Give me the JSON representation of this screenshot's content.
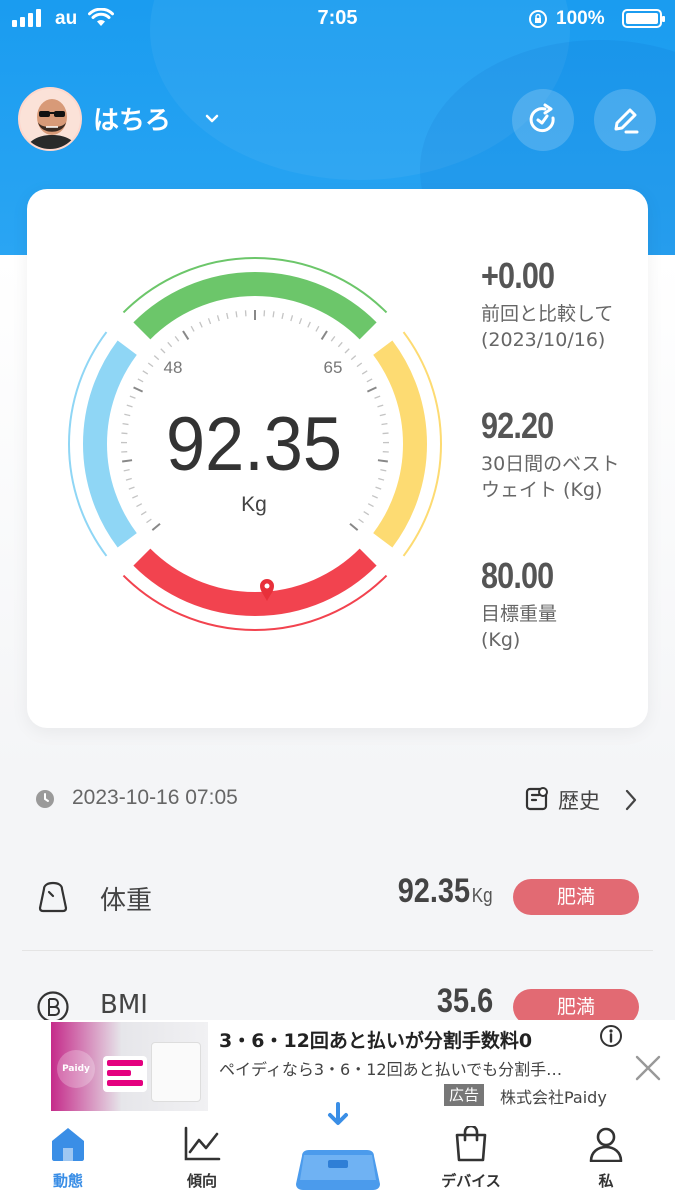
{
  "status_bar": {
    "carrier": "au",
    "time": "7:05",
    "battery_percent": "100%"
  },
  "header": {
    "username": "はちろ",
    "icons": [
      "avatar",
      "chevron-down-icon",
      "sync-icon",
      "edit-icon"
    ]
  },
  "gauge": {
    "weight": "92.35",
    "unit": "Kg",
    "range_low_label": "48",
    "range_high_label": "65",
    "segment_colors": {
      "underweight": "#8fd6f5",
      "normal": "#6cc66a",
      "overweight": "#fddb72",
      "obese": "#f2434f"
    },
    "pointer_color": "#e8303a"
  },
  "stats": [
    {
      "value": "+0.00",
      "label_line1": "前回と比較して",
      "label_line2": "(2023/10/16)"
    },
    {
      "value": "92.20",
      "label_line1": "30日間のベスト",
      "label_line2": "ウェイト (Kg)"
    },
    {
      "value": "80.00",
      "label_line1": "目標重量",
      "label_line2": "(Kg)"
    }
  ],
  "record": {
    "datetime": "2023-10-16 07:05",
    "history_label": "歴史"
  },
  "metrics": [
    {
      "name": "体重",
      "value": "92.35",
      "unit": "Kg",
      "status": "肥満",
      "status_color": "#e26a73"
    },
    {
      "name": "BMI",
      "value": "35.6",
      "unit": "",
      "status": "肥満",
      "status_color": "#e26a73"
    }
  ],
  "ad": {
    "title": "3・6・12回あと払いが分割手数料0",
    "description": "ペイディなら3・6・12回あと払いでも分割手…",
    "tag": "広告",
    "advertiser": "株式会社Paidy",
    "image_logo": "Paidy"
  },
  "tabbar": {
    "items": [
      {
        "label": "動態",
        "icon": "home-icon",
        "active": true
      },
      {
        "label": "傾向",
        "icon": "trend-icon",
        "active": false
      },
      {
        "label": "デバイス",
        "icon": "device-icon",
        "active": false
      },
      {
        "label": "私",
        "icon": "person-icon",
        "active": false
      }
    ],
    "center_button": "scale-icon",
    "accent_color": "#3a8ee6"
  }
}
